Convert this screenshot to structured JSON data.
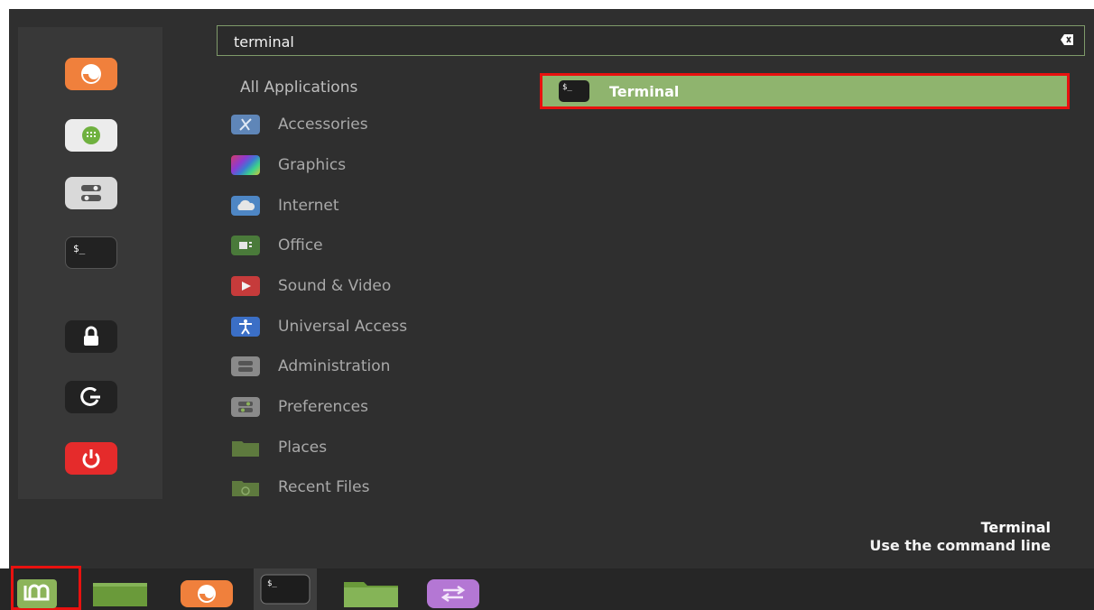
{
  "search": {
    "value": "terminal",
    "clear_icon": "backspace-clear-icon"
  },
  "favorites": [
    {
      "name": "firefox-icon",
      "color": "#f0803c"
    },
    {
      "name": "software-manager-icon",
      "color": "#6fb13f"
    },
    {
      "name": "system-settings-icon",
      "color": "#d9d9d9"
    },
    {
      "name": "terminal-icon",
      "color": "#222222"
    },
    {
      "name": "lock-screen-icon",
      "color": "#222222"
    },
    {
      "name": "logout-icon",
      "color": "#222222"
    },
    {
      "name": "power-icon",
      "color": "#e52b2b"
    }
  ],
  "categories": {
    "all": "All Applications",
    "items": [
      {
        "label": "Accessories",
        "icon": "accessories-icon"
      },
      {
        "label": "Graphics",
        "icon": "graphics-icon"
      },
      {
        "label": "Internet",
        "icon": "internet-cloud-icon"
      },
      {
        "label": "Office",
        "icon": "office-icon"
      },
      {
        "label": "Sound & Video",
        "icon": "sound-video-icon"
      },
      {
        "label": "Universal Access",
        "icon": "universal-access-icon"
      },
      {
        "label": "Administration",
        "icon": "administration-icon"
      },
      {
        "label": "Preferences",
        "icon": "preferences-icon"
      },
      {
        "label": "Places",
        "icon": "places-folder-icon"
      },
      {
        "label": "Recent Files",
        "icon": "recent-files-icon"
      }
    ]
  },
  "results": [
    {
      "label": "Terminal",
      "icon": "terminal-icon"
    }
  ],
  "description": {
    "title": "Terminal",
    "text": "Use the command line"
  },
  "panel": {
    "items": [
      {
        "name": "mint-menu-icon"
      },
      {
        "name": "show-desktop-icon"
      },
      {
        "name": "firefox-icon"
      },
      {
        "name": "terminal-icon"
      },
      {
        "name": "files-folder-icon"
      },
      {
        "name": "workspace-switcher-icon"
      }
    ]
  },
  "colors": {
    "menu_bg": "#2f2f2f",
    "selected_bg": "#8fb46e",
    "highlight_border": "#e8110f",
    "mint_green": "#8cb45a"
  }
}
